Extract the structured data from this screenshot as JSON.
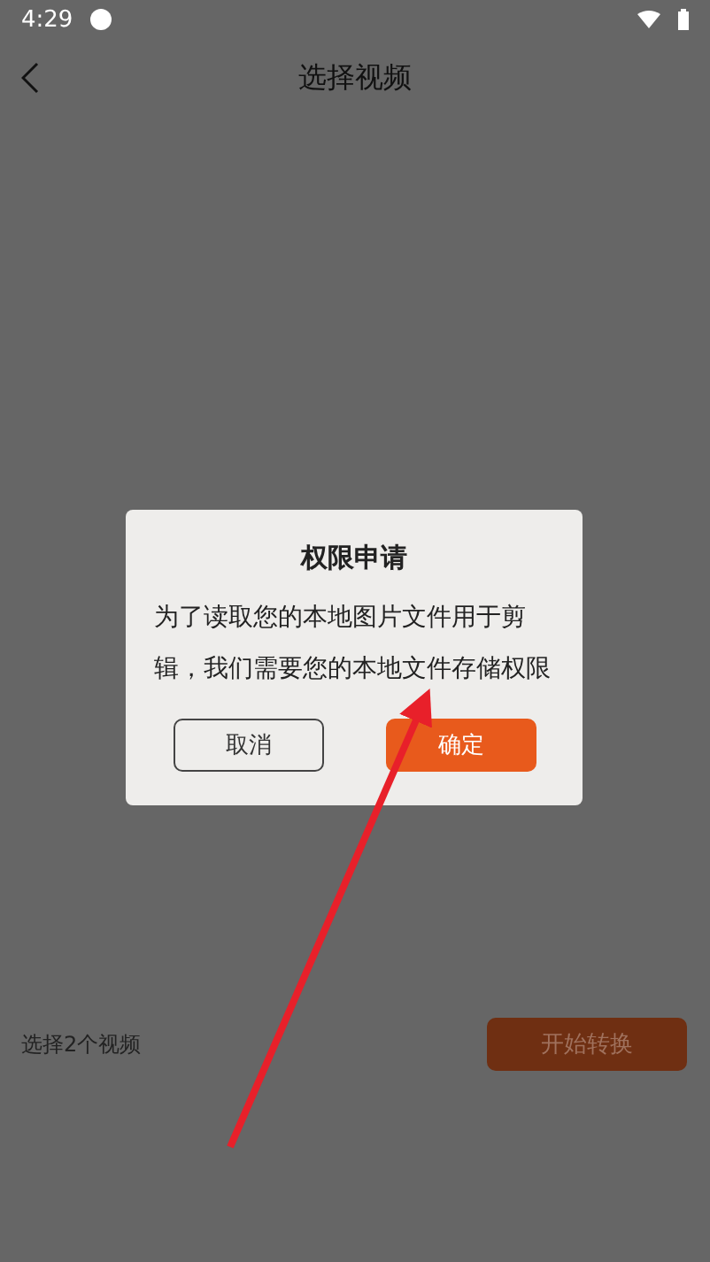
{
  "status_bar": {
    "time": "4:29"
  },
  "header": {
    "title": "选择视频"
  },
  "footer": {
    "selection": "选择2个视频",
    "convert_button": {
      "label": "开始转换",
      "disabled": true
    }
  },
  "dialog": {
    "title": "权限申请",
    "message": "为了读取您的本地图片文件用于剪辑，我们需要您的本地文件存储权限",
    "buttons": [
      {
        "label": "取消",
        "kind": "secondary"
      },
      {
        "label": "确定",
        "kind": "primary"
      }
    ]
  }
}
